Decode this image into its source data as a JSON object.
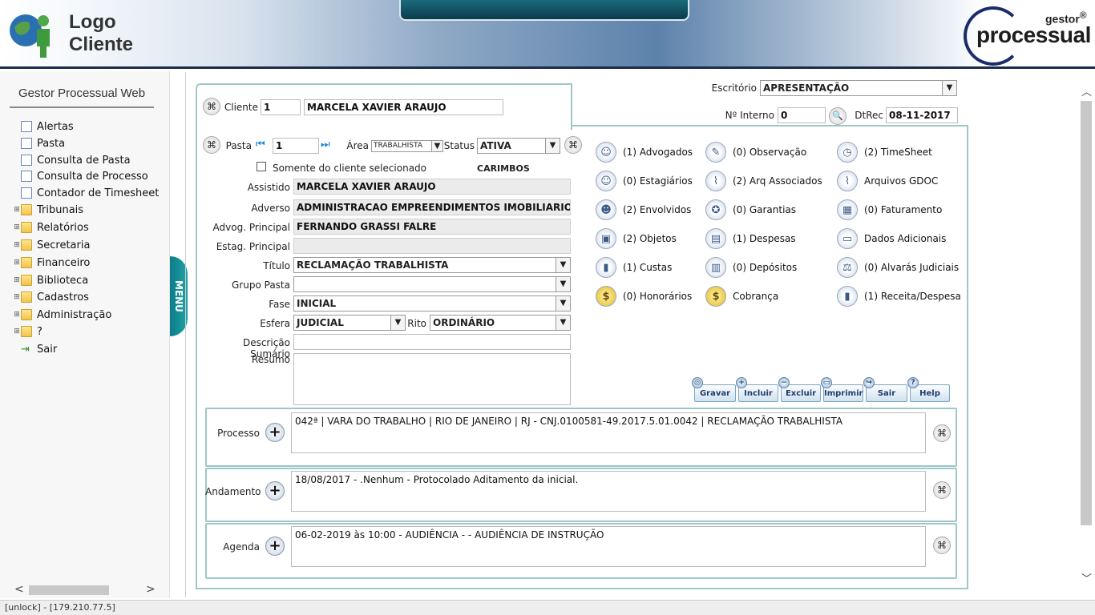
{
  "header": {
    "logo_line1": "Logo",
    "logo_line2": "Cliente",
    "brand_small": "gestor",
    "brand_reg": "®",
    "brand_big": "processual"
  },
  "sidebar": {
    "title": "Gestor Processual Web",
    "items": [
      {
        "label": "Alertas",
        "type": "doc"
      },
      {
        "label": "Pasta",
        "type": "doc"
      },
      {
        "label": "Consulta de Pasta",
        "type": "doc"
      },
      {
        "label": "Consulta de Processo",
        "type": "doc"
      },
      {
        "label": "Contador de Timesheet",
        "type": "doc"
      },
      {
        "label": "Tribunais",
        "type": "folder"
      },
      {
        "label": "Relatórios",
        "type": "folder"
      },
      {
        "label": "Secretaria",
        "type": "folder"
      },
      {
        "label": "Financeiro",
        "type": "folder"
      },
      {
        "label": "Biblioteca",
        "type": "folder"
      },
      {
        "label": "Cadastros",
        "type": "folder"
      },
      {
        "label": "Administração",
        "type": "folder"
      },
      {
        "label": "?",
        "type": "folder"
      },
      {
        "label": "Sair",
        "type": "exit"
      }
    ]
  },
  "menu_tab": "MENU",
  "form": {
    "escritorio_label": "Escritório",
    "escritorio_value": "APRESENTAÇÃO",
    "ninterno_label": "Nº Interno",
    "ninterno_value": "0",
    "dtrec_label": "DtRec",
    "dtrec_value": "08-11-2017",
    "cliente_label": "Cliente",
    "cliente_code": "1",
    "cliente_name": "MARCELA XAVIER ARAUJO",
    "pasta_label": "Pasta",
    "pasta_value": "1",
    "area_label": "Área",
    "area_value": "TRABALHISTA",
    "status_label": "Status",
    "status_value": "ATIVA",
    "somente_label": "Somente do cliente selecionado",
    "carimbos_label": "CARIMBOS",
    "assistido_label": "Assistido",
    "assistido_value": "MARCELA XAVIER ARAUJO",
    "adverso_label": "Adverso",
    "adverso_value": "ADMINISTRACAO EMPREENDIMENTOS IMOBILIARIOS I",
    "advog_label": "Advog. Principal",
    "advog_value": "FERNANDO GRASSI FALRE",
    "estag_label": "Estag. Principal",
    "estag_value": "",
    "titulo_label": "Título",
    "titulo_value": "RECLAMAÇÃO TRABALHISTA",
    "grupo_label": "Grupo Pasta",
    "grupo_value": "",
    "fase_label": "Fase",
    "fase_value": "INICIAL",
    "esfera_label": "Esfera",
    "esfera_value": "JUDICIAL",
    "rito_label": "Rito",
    "rito_value": "ORDINÁRIO",
    "descricao_label": "Descrição Sumário",
    "descricao_value": "",
    "resumo_label": "Resumo",
    "resumo_value": ""
  },
  "links": [
    {
      "label": "(1) Advogados",
      "icon": "user-icon",
      "glyph": "☺"
    },
    {
      "label": "(0) Observação",
      "icon": "tag-icon",
      "glyph": "✎"
    },
    {
      "label": "(2) TimeSheet",
      "icon": "clock-icon",
      "glyph": "◷"
    },
    {
      "label": "(0) Estagiários",
      "icon": "user-icon",
      "glyph": "☺"
    },
    {
      "label": "(2) Arq Associados",
      "icon": "paperclip-icon",
      "glyph": "⌇"
    },
    {
      "label": "Arquivos GDOC",
      "icon": "paperclip-icon",
      "glyph": "⌇"
    },
    {
      "label": "(2) Envolvidos",
      "icon": "group-icon",
      "glyph": "☻"
    },
    {
      "label": "(0) Garantias",
      "icon": "badge-icon",
      "glyph": "✪"
    },
    {
      "label": "(0) Faturamento",
      "icon": "calculator-icon",
      "glyph": "▦"
    },
    {
      "label": "(2) Objetos",
      "icon": "box-icon",
      "glyph": "▣"
    },
    {
      "label": "(1) Despesas",
      "icon": "ledger-icon",
      "glyph": "▤"
    },
    {
      "label": "Dados Adicionais",
      "icon": "cards-icon",
      "glyph": "▭"
    },
    {
      "label": "(1) Custas",
      "icon": "book-icon",
      "glyph": "▮"
    },
    {
      "label": "(0) Depósitos",
      "icon": "deposit-icon",
      "glyph": "▥"
    },
    {
      "label": "(0) Alvarás Judiciais",
      "icon": "scales-icon",
      "glyph": "⚖"
    },
    {
      "label": "(0) Honorários",
      "icon": "dollar-icon",
      "glyph": "$"
    },
    {
      "label": "Cobrança",
      "icon": "dollar-icon",
      "glyph": "$"
    },
    {
      "label": "(1) Receita/Despesa",
      "icon": "book-icon",
      "glyph": "▮"
    }
  ],
  "toolbar": {
    "gravar": "Gravar",
    "incluir": "Incluir",
    "excluir": "Excluir",
    "imprimir": "Imprimir",
    "sair": "Sair",
    "help": "Help"
  },
  "sections": {
    "processo_label": "Processo",
    "processo_value": "042ª | VARA DO TRABALHO | RIO DE JANEIRO | RJ - CNJ.0100581-49.2017.5.01.0042 | RECLAMAÇÃO TRABALHISTA",
    "andamento_label": "Andamento",
    "andamento_value": "18/08/2017 - .Nenhum - Protocolado Aditamento da inicial.",
    "agenda_label": "Agenda",
    "agenda_value": "06-02-2019 às 10:00 - AUDIÊNCIA - - AUDIÊNCIA DE INSTRUÇÃO"
  },
  "status_bar": "[unlock] - [179.210.77.5]"
}
